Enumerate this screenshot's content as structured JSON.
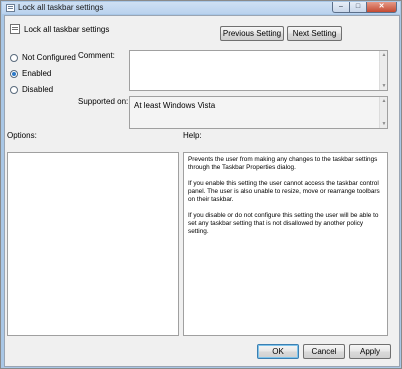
{
  "window": {
    "title": "Lock all taskbar settings",
    "controls": {
      "minimize": "–",
      "maximize": "□",
      "close": "✕"
    }
  },
  "header": {
    "title": "Lock all taskbar settings",
    "previous_button": "Previous Setting",
    "next_button": "Next Setting"
  },
  "state": {
    "options": [
      {
        "label": "Not Configured",
        "selected": false
      },
      {
        "label": "Enabled",
        "selected": true
      },
      {
        "label": "Disabled",
        "selected": false
      }
    ]
  },
  "comment": {
    "label": "Comment:",
    "value": ""
  },
  "supported_on": {
    "label": "Supported on:",
    "value": "At least Windows Vista"
  },
  "options_label": "Options:",
  "help": {
    "label": "Help:",
    "paragraphs": [
      "Prevents the user from making any changes to the taskbar settings through the Taskbar Properties dialog.",
      "If you enable this setting the user cannot access the taskbar control panel. The user is also unable to resize, move or rearrange toolbars on their taskbar.",
      "If you disable or do not configure this setting the user will be able to set any taskbar setting that is not disallowed by another policy setting."
    ]
  },
  "footer": {
    "ok": "OK",
    "cancel": "Cancel",
    "apply": "Apply"
  },
  "icons": {
    "scroll_up": "▲",
    "scroll_down": "▼"
  }
}
